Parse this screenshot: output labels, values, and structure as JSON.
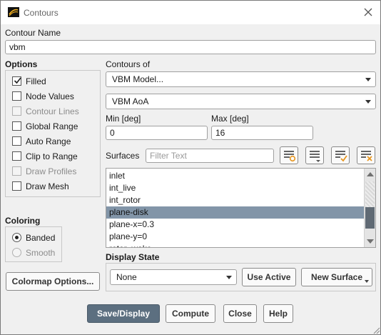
{
  "window": {
    "title": "Contours"
  },
  "contour_name": {
    "label": "Contour Name",
    "value": "vbm"
  },
  "options": {
    "label": "Options",
    "items": [
      {
        "label": "Filled",
        "checked": true,
        "enabled": true
      },
      {
        "label": "Node Values",
        "checked": false,
        "enabled": true
      },
      {
        "label": "Contour Lines",
        "checked": false,
        "enabled": false
      },
      {
        "label": "Global Range",
        "checked": false,
        "enabled": true
      },
      {
        "label": "Auto Range",
        "checked": false,
        "enabled": true
      },
      {
        "label": "Clip to Range",
        "checked": false,
        "enabled": true
      },
      {
        "label": "Draw Profiles",
        "checked": false,
        "enabled": false
      },
      {
        "label": "Draw Mesh",
        "checked": false,
        "enabled": true
      }
    ]
  },
  "coloring": {
    "label": "Coloring",
    "banded": "Banded",
    "smooth": "Smooth",
    "selected": "Banded"
  },
  "colormap_button": "Colormap Options...",
  "contours_of": {
    "label": "Contours of",
    "category": "VBM Model...",
    "variable": "VBM AoA"
  },
  "range": {
    "min_label": "Min [deg]",
    "min_value": "0",
    "max_label": "Max [deg]",
    "max_value": "16"
  },
  "surfaces": {
    "label": "Surfaces",
    "filter_placeholder": "Filter Text",
    "items": [
      "inlet",
      "int_live",
      "int_rotor",
      "plane-disk",
      "plane-x=0.3",
      "plane-y=0",
      "rotor_wake"
    ],
    "selected": "plane-disk"
  },
  "display_state": {
    "label": "Display State",
    "value": "None",
    "use_active": "Use Active",
    "new_surface": "New Surface"
  },
  "buttons": {
    "save_display": "Save/Display",
    "compute": "Compute",
    "close": "Close",
    "help": "Help"
  },
  "colors": {
    "accent": "#5c6f80",
    "selection": "#8295a8",
    "icon_orange": "#e8961e"
  }
}
